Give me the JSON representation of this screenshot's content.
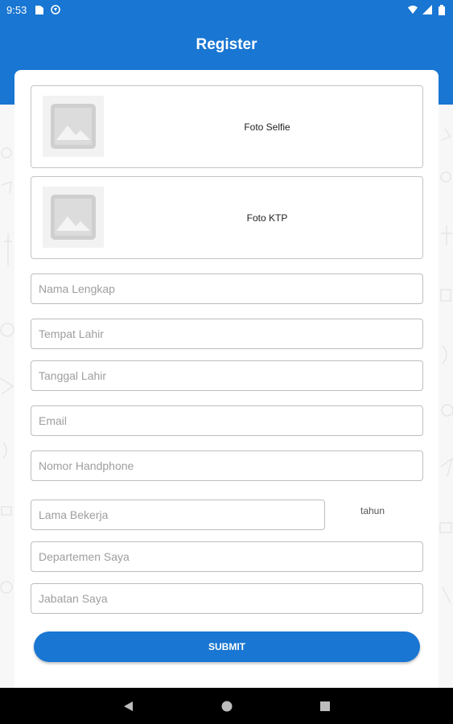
{
  "status_bar": {
    "time": "9:53",
    "icons": [
      "sim-card-icon",
      "sync-icon",
      "wifi-icon",
      "signal-icon",
      "battery-icon"
    ]
  },
  "header": {
    "title": "Register",
    "color": "#1976d2"
  },
  "photos": {
    "selfie_label": "Foto Selfie",
    "ktp_label": "Foto KTP"
  },
  "form": {
    "nama_lengkap": {
      "placeholder": "Nama Lengkap",
      "value": ""
    },
    "tempat_lahir": {
      "placeholder": "Tempat Lahir",
      "value": ""
    },
    "tanggal_lahir": {
      "placeholder": "Tanggal Lahir",
      "value": ""
    },
    "email": {
      "placeholder": "Email",
      "value": ""
    },
    "nomor_handphone": {
      "placeholder": "Nomor Handphone",
      "value": ""
    },
    "lama_bekerja": {
      "placeholder": "Lama Bekerja",
      "value": "",
      "unit": "tahun"
    },
    "departemen": {
      "placeholder": "Departemen Saya",
      "value": ""
    },
    "jabatan": {
      "placeholder": "Jabatan Saya",
      "value": ""
    }
  },
  "submit_label": "SUBMIT",
  "nav": {
    "icons": [
      "back-icon",
      "home-icon",
      "recents-icon"
    ]
  }
}
